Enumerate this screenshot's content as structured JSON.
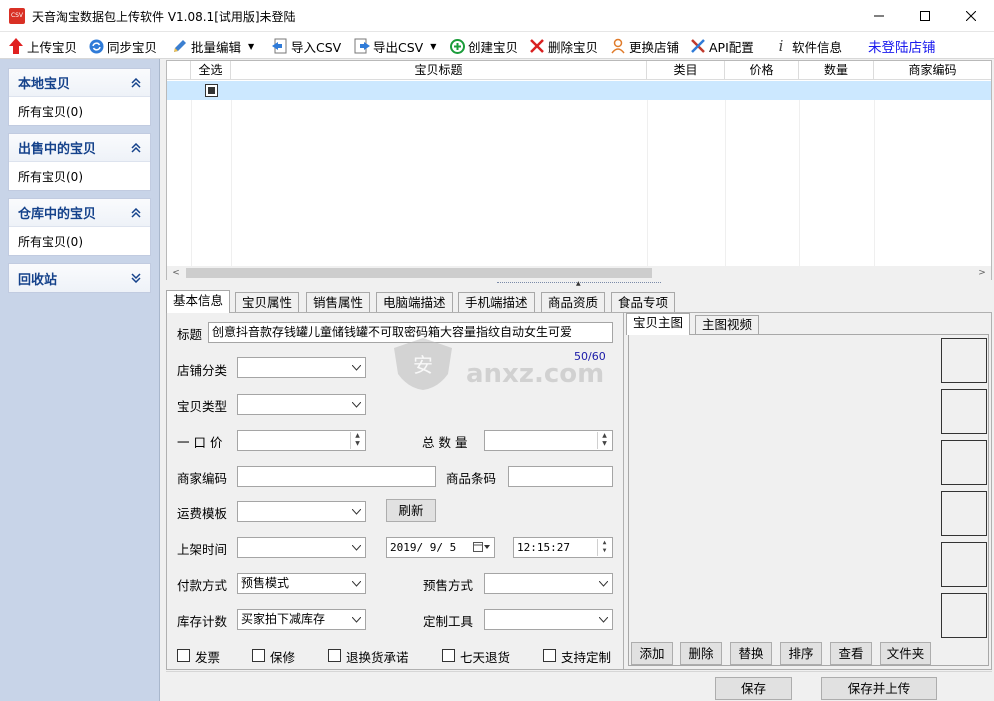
{
  "window": {
    "app_icon_text": "CSV",
    "title": "天音淘宝数据包上传软件 V1.08.1[试用版]未登陆"
  },
  "toolbar": {
    "upload": "上传宝贝",
    "sync": "同步宝贝",
    "batch_edit": "批量编辑",
    "import_csv": "导入CSV",
    "export_csv": "导出CSV",
    "create": "创建宝贝",
    "delete": "删除宝贝",
    "switch_shop": "更换店铺",
    "api": "API配置",
    "info": "软件信息",
    "status": "未登陆店铺",
    "colors": {
      "upload": "#e02020",
      "sync": "#2f7bd8",
      "create": "#1a9c3a",
      "delete": "#d92020",
      "status": "#1a1aee"
    }
  },
  "sidebar": {
    "panels": [
      {
        "title": "本地宝贝",
        "item": "所有宝贝(0)",
        "expanded": true
      },
      {
        "title": "出售中的宝贝",
        "item": "所有宝贝(0)",
        "expanded": true
      },
      {
        "title": "仓库中的宝贝",
        "item": "所有宝贝(0)",
        "expanded": true
      },
      {
        "title": "回收站",
        "expanded": false
      }
    ]
  },
  "grid": {
    "columns": [
      "全选",
      "宝贝标题",
      "类目",
      "价格",
      "数量",
      "商家编码"
    ],
    "rows": [
      {
        "selected": true,
        "checked": true
      }
    ]
  },
  "tabs": [
    "基本信息",
    "宝贝属性",
    "销售属性",
    "电脑端描述",
    "手机端描述",
    "商品资质",
    "食品专项"
  ],
  "form": {
    "title_label": "标题",
    "title_value": "创意抖音款存钱罐儿童储钱罐不可取密码箱大容量指纹自动女生可爱",
    "title_counter": "50/60",
    "shop_category_label": "店铺分类",
    "type_label": "宝贝类型",
    "price_label": "一 口 价",
    "total_qty_label": "总 数 量",
    "merchant_code_label": "商家编码",
    "barcode_label": "商品条码",
    "shipping_label": "运费模板",
    "refresh_button": "刷新",
    "listing_time_label": "上架时间",
    "listing_date": "2019/ 9/ 5",
    "listing_time": "12:15:27",
    "payment_label": "付款方式",
    "payment_value": "预售模式",
    "presale_label": "预售方式",
    "stock_label": "库存计数",
    "stock_value": "买家拍下减库存",
    "custom_tool_label": "定制工具",
    "checkboxes": [
      "发票",
      "保修",
      "退换货承诺",
      "七天退货",
      "支持定制"
    ]
  },
  "image_panel": {
    "tabs": [
      "宝贝主图",
      "主图视频"
    ],
    "buttons": [
      "添加",
      "删除",
      "替换",
      "排序",
      "查看",
      "文件夹"
    ]
  },
  "watermark": {
    "text": "anxz.com"
  },
  "bottom": {
    "save": "保存",
    "save_upload": "保存并上传"
  }
}
